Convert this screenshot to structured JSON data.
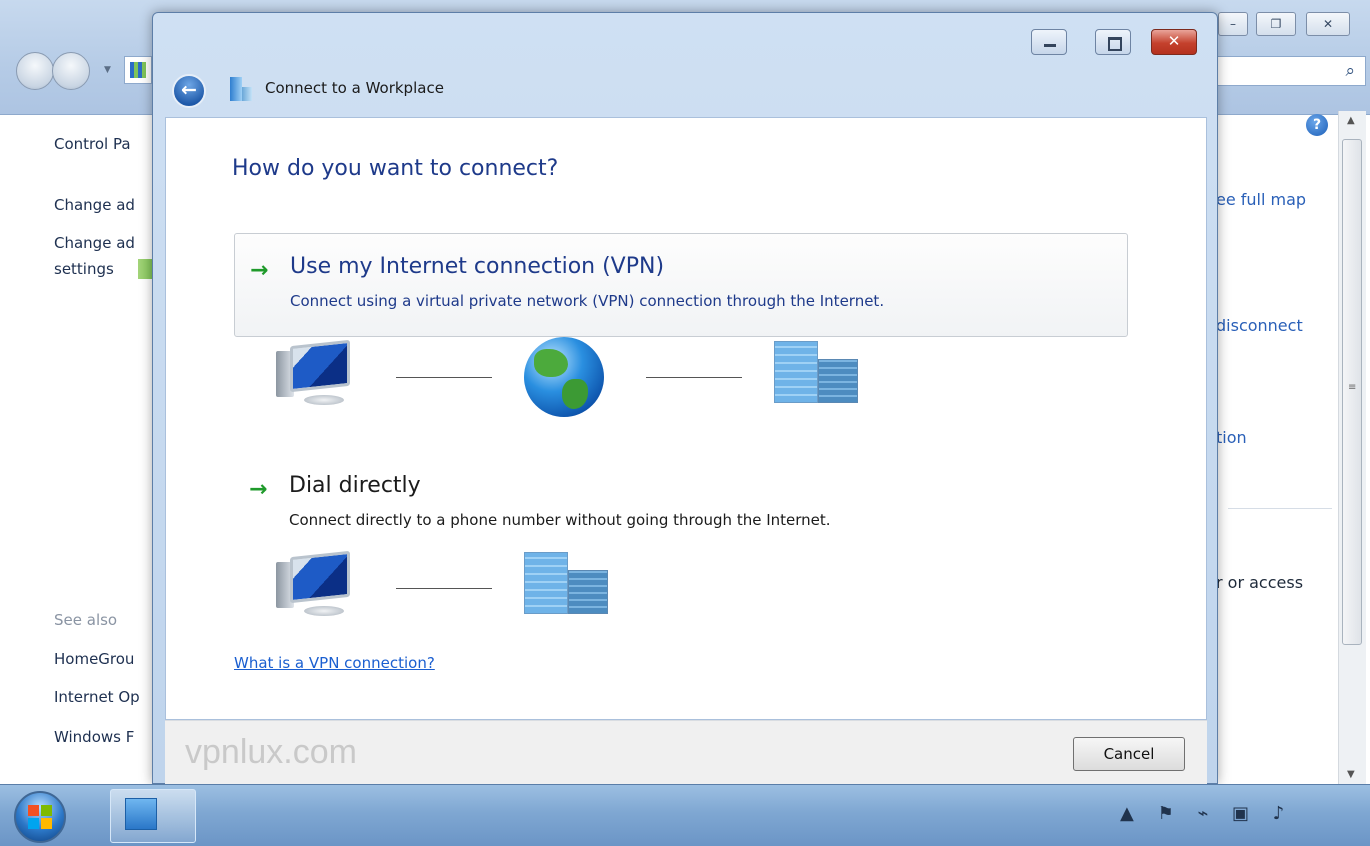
{
  "background_window": {
    "left_panel": {
      "control_panel_home": "Control Pa",
      "change_adapter": "Change ad",
      "change_advanced": "Change ad",
      "settings": "settings",
      "see_also": "See also",
      "homegroup": "HomeGrou",
      "internet_options": "Internet Op",
      "windows_firewall": "Windows F"
    },
    "right_panel": {
      "see_full_map": "ee full map",
      "disconnect": "disconnect",
      "connection": "tion",
      "access": "r or access"
    }
  },
  "dialog": {
    "title": "Connect to a Workplace",
    "heading": "How do you want to connect?",
    "options": [
      {
        "title": "Use my Internet connection (VPN)",
        "description": "Connect using a virtual private network (VPN) connection through the Internet."
      },
      {
        "title": "Dial directly",
        "description": "Connect directly to a phone number without going through the Internet."
      }
    ],
    "help_link": "What is a VPN connection?",
    "watermark": "vpnlux.com",
    "cancel_label": "Cancel"
  },
  "icons": {
    "option_arrow": "→",
    "back": "←",
    "help": "?",
    "search": "⌕"
  },
  "colors": {
    "heading": "#1e3a8a",
    "link": "#1b5fd0",
    "arrow_green": "#1f9a2b",
    "close_red": "#c4412d"
  }
}
